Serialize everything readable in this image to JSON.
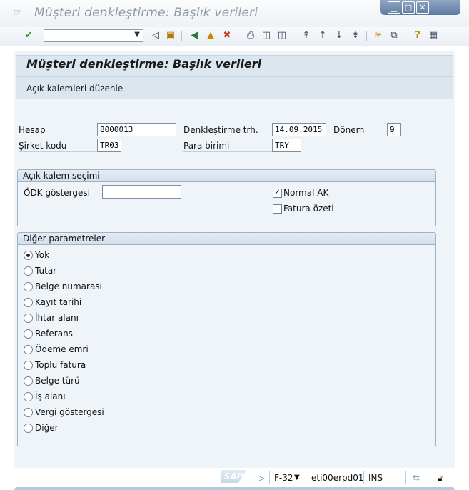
{
  "window": {
    "title": "Müşteri denkleştirme: Başlık verileri",
    "controls": {
      "minimize": "▁",
      "maximize": "□",
      "close": "✕"
    }
  },
  "toolbar": {
    "command_field_value": "",
    "icons": [
      "check-icon",
      "back-arrow-icon",
      "save-icon",
      "back-icon",
      "exit-icon",
      "cancel-icon",
      "print-icon",
      "find-icon",
      "find-next-icon",
      "first-page-icon",
      "previous-page-icon",
      "next-page-icon",
      "last-page-icon",
      "create-session-icon",
      "shortcut-icon",
      "help-icon",
      "layout-icon"
    ]
  },
  "header": {
    "title": "Müşteri denkleştirme: Başlık verileri",
    "action": "Açık kalemleri düzenle"
  },
  "fields": {
    "hesap_label": "Hesap",
    "hesap_value": "8000013",
    "denk_trh_label": "Denkleştirme trh.",
    "denk_trh_value": "14.09.2015",
    "donem_label": "Dönem",
    "donem_value": "9",
    "sirket_label": "Şirket kodu",
    "sirket_value": "TR03",
    "para_label": "Para birimi",
    "para_value": "TRY"
  },
  "acik_kalem": {
    "title": "Açık kalem seçimi",
    "odk_label": "ÖDK göstergesi",
    "odk_value": "",
    "normal_ak_label": "Normal AK",
    "normal_ak_checked": true,
    "fatura_ozeti_label": "Fatura özeti",
    "fatura_ozeti_checked": false
  },
  "diger": {
    "title": "Diğer parametreler",
    "options": [
      "Yok",
      "Tutar",
      "Belge numarası",
      "Kayıt tarihi",
      "İhtar alanı",
      "Referans",
      "Ödeme emri",
      "Toplu fatura",
      "Belge türü",
      "İş alanı",
      "Vergi göstergesi",
      "Diğer"
    ],
    "selected": "Yok"
  },
  "status": {
    "logo": "SAP",
    "transaction": "F-32",
    "server": "eti00erpd01",
    "mode": "INS"
  }
}
